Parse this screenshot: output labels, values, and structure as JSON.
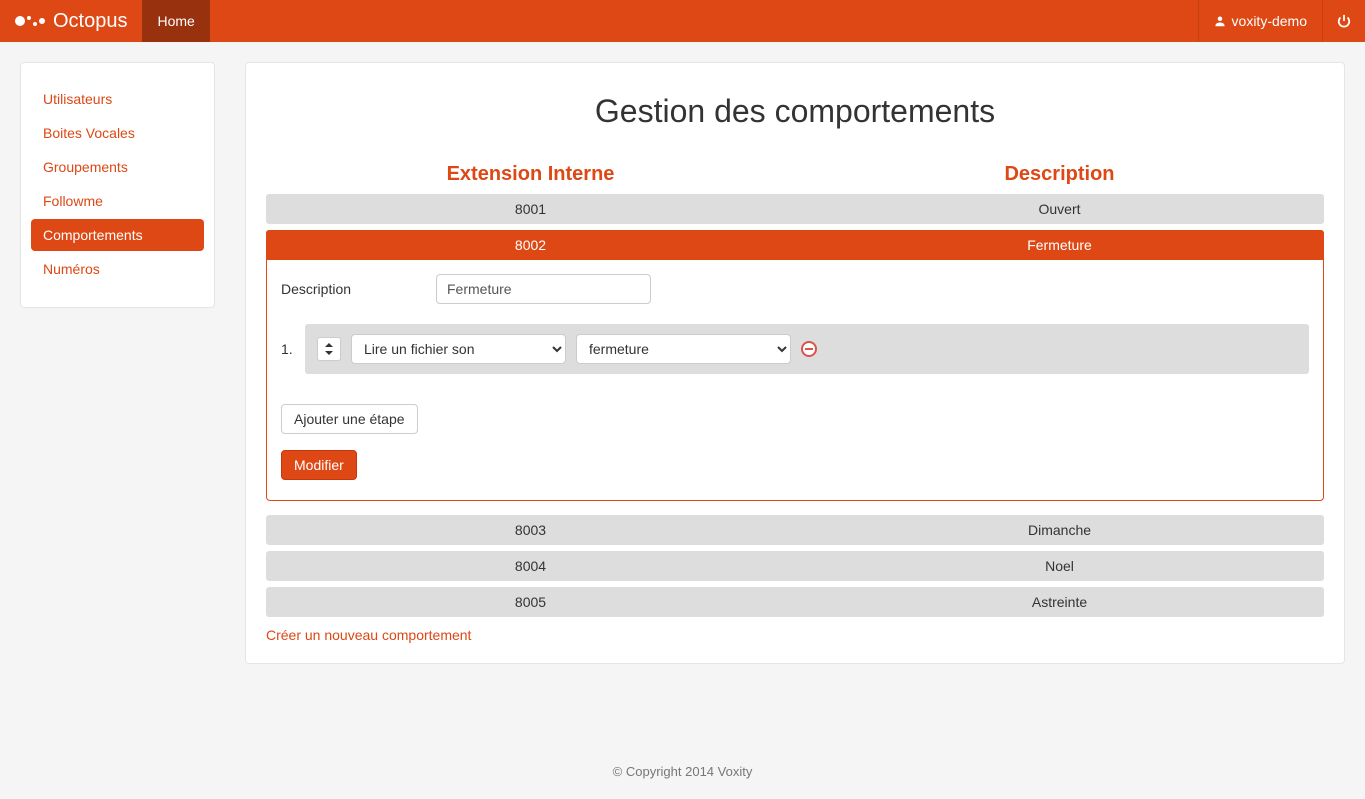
{
  "brand": "Octopus",
  "nav": {
    "home": "Home",
    "user": "voxity-demo"
  },
  "sidebar": {
    "items": [
      {
        "label": "Utilisateurs"
      },
      {
        "label": "Boites Vocales"
      },
      {
        "label": "Groupements"
      },
      {
        "label": "Followme"
      },
      {
        "label": "Comportements"
      },
      {
        "label": "Numéros"
      }
    ]
  },
  "page": {
    "title": "Gestion des comportements",
    "col_ext": "Extension Interne",
    "col_desc": "Description"
  },
  "rows": [
    {
      "ext": "8001",
      "desc": "Ouvert"
    },
    {
      "ext": "8002",
      "desc": "Fermeture"
    },
    {
      "ext": "8003",
      "desc": "Dimanche"
    },
    {
      "ext": "8004",
      "desc": "Noel"
    },
    {
      "ext": "8005",
      "desc": "Astreinte"
    }
  ],
  "edit": {
    "desc_label": "Description",
    "desc_value": "Fermeture",
    "step_index": "1.",
    "action_select": "Lire un fichier son",
    "file_select": "fermeture",
    "add_step": "Ajouter une étape",
    "modify": "Modifier"
  },
  "create_link": "Créer un nouveau comportement",
  "footer": "© Copyright 2014 Voxity"
}
